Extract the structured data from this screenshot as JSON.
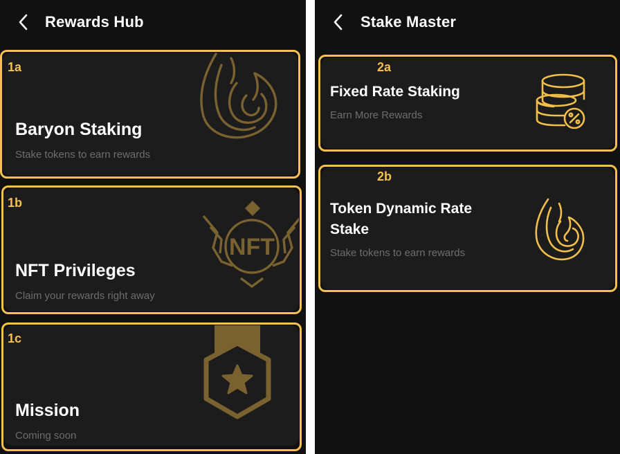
{
  "left": {
    "header": {
      "title": "Rewards Hub"
    },
    "cards": [
      {
        "tag": "1a",
        "title": "Baryon Staking",
        "subtitle": "Stake tokens to earn rewards",
        "icon": "flame-icon"
      },
      {
        "tag": "1b",
        "title": "NFT Privileges",
        "subtitle": "Claim your rewards right away",
        "icon": "nft-badge-icon"
      },
      {
        "tag": "1c",
        "title": "Mission",
        "subtitle": "Coming soon",
        "icon": "star-medal-icon"
      }
    ]
  },
  "right": {
    "header": {
      "title": "Stake Master"
    },
    "cards": [
      {
        "tag": "2a",
        "title": "Fixed Rate Staking",
        "subtitle": "Earn More Rewards",
        "icon": "coins-percent-icon"
      },
      {
        "tag": "2b",
        "title_line1": "Token Dynamic Rate",
        "title_line2": "Stake",
        "subtitle": "Stake tokens to earn rewards",
        "icon": "flame-icon"
      }
    ]
  },
  "colors": {
    "background": "#111111",
    "card": "#1c1c1c",
    "highlight": "#f5c14e",
    "icon_dim_gold": "#7a6230",
    "icon_bright_gold": "#f2c04a",
    "subtitle": "#6e6e6e",
    "title": "#ffffff"
  }
}
